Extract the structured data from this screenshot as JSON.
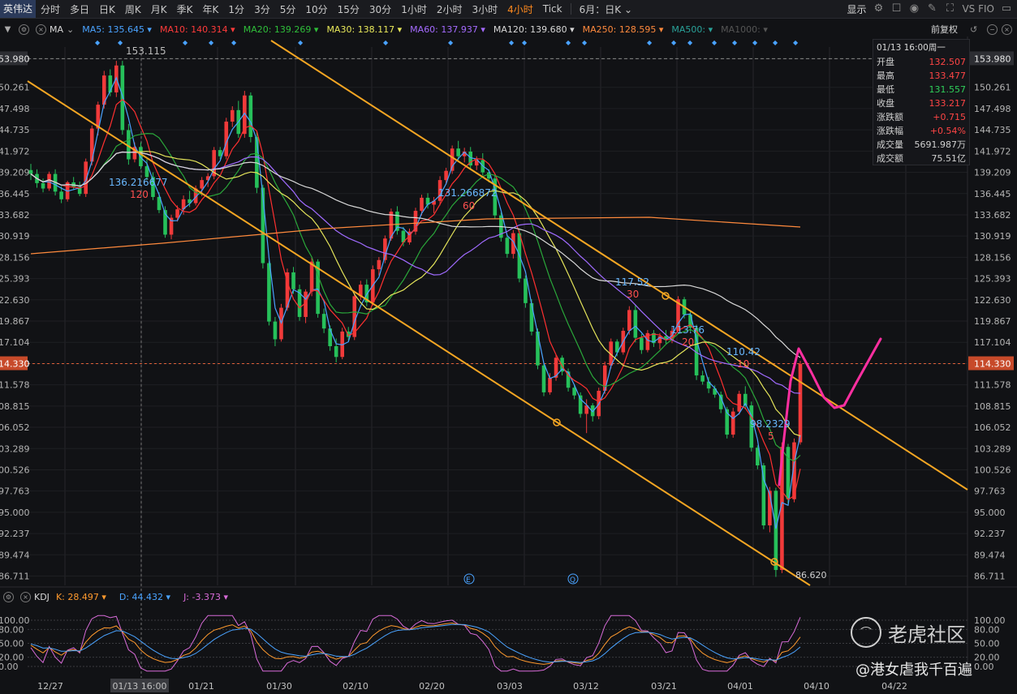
{
  "topbar": {
    "symbol": "英伟达",
    "timeframes": [
      "分时",
      "多日",
      "日K",
      "周K",
      "月K",
      "季K",
      "年K",
      "1分",
      "3分",
      "5分",
      "10分",
      "15分",
      "30分",
      "1小时",
      "2小时",
      "3小时",
      "4小时",
      "Tick"
    ],
    "active_timeframe": "4小时",
    "range_select": "6月：日K",
    "display_label": "显示",
    "vsfio_label": "VS FIO"
  },
  "ma_bar": {
    "label": "MA",
    "items": [
      {
        "name": "MA5:",
        "value": "135.645",
        "color": "#4aa3ff"
      },
      {
        "name": "MA10:",
        "value": "140.314",
        "color": "#ff3b3b"
      },
      {
        "name": "MA20:",
        "value": "139.269",
        "color": "#2fbf3a"
      },
      {
        "name": "MA30:",
        "value": "138.117",
        "color": "#e8e85a"
      },
      {
        "name": "MA60:",
        "value": "137.937",
        "color": "#a56bff"
      },
      {
        "name": "MA120:",
        "value": "139.680",
        "color": "#d8d8d8"
      },
      {
        "name": "MA250:",
        "value": "128.595",
        "color": "#ff8a3d"
      },
      {
        "name": "MA500:",
        "value": "",
        "color": "#2aa39a"
      },
      {
        "name": "MA1000:",
        "value": "",
        "color": "#555"
      }
    ],
    "adjust_label": "前复权"
  },
  "info_panel": {
    "header": "01/13 16:00周一",
    "rows": [
      {
        "k": "开盘",
        "v": "132.507",
        "color": "#ff4545"
      },
      {
        "k": "最高",
        "v": "133.477",
        "color": "#ff4545"
      },
      {
        "k": "最低",
        "v": "131.557",
        "color": "#2fcf5a"
      },
      {
        "k": "收盘",
        "v": "133.217",
        "color": "#ff4545"
      },
      {
        "k": "涨跌额",
        "v": "+0.715",
        "color": "#ff4545"
      },
      {
        "k": "涨跌幅",
        "v": "+0.54%",
        "color": "#ff4545"
      },
      {
        "k": "成交量",
        "v": "5691.987万",
        "color": "#d0d0d0"
      },
      {
        "k": "成交额",
        "v": "75.51亿",
        "color": "#d0d0d0"
      }
    ]
  },
  "kdj_bar": {
    "label": "KDJ",
    "items": [
      {
        "name": "K:",
        "value": "28.497",
        "color": "#ff9a2e"
      },
      {
        "name": "D:",
        "value": "44.432",
        "color": "#4aa3ff"
      },
      {
        "name": "J:",
        "value": "-3.373",
        "color": "#d86bd8"
      }
    ]
  },
  "chart_data": {
    "type": "candlestick",
    "y_axis_ticks": [
      "153.980",
      "150.261",
      "147.498",
      "144.735",
      "141.972",
      "139.209",
      "136.445",
      "133.682",
      "130.919",
      "128.156",
      "125.393",
      "122.630",
      "119.867",
      "117.104",
      "114.330",
      "111.578",
      "108.815",
      "106.052",
      "103.289",
      "100.526",
      "97.763",
      "95.000",
      "92.237",
      "89.474",
      "86.711"
    ],
    "y_axis_ticks_visible_left": [
      "53.980",
      "50.261",
      "47.498",
      "44.735",
      "41.972",
      "39.209",
      "36.445",
      "33.682",
      "30.919",
      "28.156",
      "25.393",
      "22.630",
      "19.867",
      "17.104",
      "14.330",
      "11.578",
      "08.815",
      "06.052",
      "03.289",
      "00.526",
      "97.763",
      "95.000",
      "92.237",
      "89.474",
      "86.711"
    ],
    "ylim": [
      85.5,
      155.5
    ],
    "x_axis_labels": [
      "12/27",
      "01/13 16:00",
      "01/21",
      "01/30",
      "02/10",
      "02/20",
      "03/03",
      "03/12",
      "03/21",
      "04/01",
      "04/10",
      "04/22"
    ],
    "price_labels": [
      {
        "text": "153.115",
        "y": 153.115
      },
      {
        "text": "136.216677",
        "y": 136.8
      },
      {
        "text": "120",
        "y": 135.3
      },
      {
        "text": "131.266872",
        "y": 134.6
      },
      {
        "text": "60",
        "y": 132.6
      },
      {
        "text": "117.52",
        "y": 123.3
      },
      {
        "text": "30",
        "y": 121.9
      },
      {
        "text": "113.76",
        "y": 117.4
      },
      {
        "text": "20",
        "y": 115.9
      },
      {
        "text": "110.42",
        "y": 114.7
      },
      {
        "text": "10",
        "y": 113.2
      },
      {
        "text": "98.2329",
        "y": 104.9
      },
      {
        "text": "5",
        "y": 103.3
      },
      {
        "text": "86.620",
        "y": 86.0
      }
    ],
    "current_price": "114.330",
    "kdj_ticks": [
      "100.00",
      "80.00",
      "50.00",
      "20.00",
      "0.00"
    ],
    "candles": [
      [
        139.5,
        140.3,
        138.2,
        139.0
      ],
      [
        139.0,
        139.6,
        137.2,
        137.8
      ],
      [
        137.8,
        138.4,
        136.6,
        137.1
      ],
      [
        137.1,
        139.3,
        136.8,
        139.0
      ],
      [
        139.0,
        139.6,
        136.2,
        136.7
      ],
      [
        136.7,
        137.4,
        135.2,
        135.7
      ],
      [
        135.7,
        138.1,
        135.4,
        137.9
      ],
      [
        137.9,
        138.6,
        136.9,
        137.3
      ],
      [
        137.3,
        138.0,
        136.1,
        136.4
      ],
      [
        136.4,
        141.0,
        136.0,
        140.6
      ],
      [
        140.6,
        145.3,
        140.1,
        144.9
      ],
      [
        144.9,
        148.4,
        144.0,
        148.0
      ],
      [
        148.0,
        152.4,
        147.5,
        151.8
      ],
      [
        151.8,
        152.6,
        149.1,
        149.6
      ],
      [
        149.6,
        153.7,
        149.0,
        153.1
      ],
      [
        153.1,
        153.7,
        144.1,
        144.7
      ],
      [
        144.7,
        145.5,
        140.2,
        140.9
      ],
      [
        140.9,
        143.1,
        140.5,
        142.5
      ],
      [
        142.5,
        143.1,
        139.6,
        140.0
      ],
      [
        140.0,
        140.9,
        138.2,
        138.6
      ],
      [
        138.6,
        139.2,
        135.6,
        136.0
      ],
      [
        136.0,
        136.6,
        133.9,
        134.3
      ],
      [
        134.3,
        134.8,
        130.7,
        131.1
      ],
      [
        131.1,
        133.7,
        130.5,
        133.3
      ],
      [
        133.3,
        134.9,
        132.8,
        134.4
      ],
      [
        134.4,
        136.2,
        133.7,
        135.7
      ],
      [
        135.7,
        136.8,
        134.7,
        135.2
      ],
      [
        135.2,
        137.5,
        134.9,
        137.1
      ],
      [
        137.1,
        138.6,
        136.1,
        138.2
      ],
      [
        138.2,
        139.1,
        137.3,
        138.7
      ],
      [
        138.7,
        142.5,
        138.3,
        142.1
      ],
      [
        142.1,
        142.5,
        140.9,
        141.3
      ],
      [
        141.3,
        146.3,
        140.9,
        145.8
      ],
      [
        145.8,
        147.8,
        145.1,
        147.3
      ],
      [
        147.3,
        148.5,
        143.7,
        144.2
      ],
      [
        144.2,
        149.8,
        143.7,
        149.2
      ],
      [
        149.2,
        149.6,
        143.1,
        143.8
      ],
      [
        143.8,
        144.5,
        136.5,
        137.2
      ],
      [
        137.2,
        137.6,
        126.7,
        127.4
      ],
      [
        127.4,
        127.7,
        119.3,
        119.8
      ],
      [
        119.8,
        120.4,
        116.6,
        117.5
      ],
      [
        117.5,
        122.1,
        117.2,
        121.6
      ],
      [
        121.6,
        126.7,
        121.2,
        126.2
      ],
      [
        126.2,
        126.9,
        123.4,
        124.0
      ],
      [
        124.0,
        124.6,
        119.9,
        120.4
      ],
      [
        120.4,
        124.0,
        119.6,
        123.7
      ],
      [
        123.7,
        128.1,
        123.1,
        127.6
      ],
      [
        127.6,
        127.9,
        120.3,
        120.8
      ],
      [
        120.8,
        121.5,
        118.3,
        118.9
      ],
      [
        118.9,
        119.3,
        116.0,
        116.6
      ],
      [
        116.6,
        117.6,
        114.5,
        115.2
      ],
      [
        115.2,
        119.0,
        114.9,
        118.5
      ],
      [
        118.5,
        119.1,
        117.3,
        117.8
      ],
      [
        117.8,
        123.5,
        117.4,
        123.1
      ],
      [
        123.1,
        125.1,
        122.6,
        124.6
      ],
      [
        124.6,
        125.3,
        121.8,
        122.3
      ],
      [
        122.3,
        127.1,
        121.9,
        126.6
      ],
      [
        126.6,
        128.2,
        125.8,
        127.8
      ],
      [
        127.8,
        131.0,
        127.4,
        130.6
      ],
      [
        130.6,
        134.5,
        130.3,
        134.1
      ],
      [
        134.1,
        134.8,
        131.1,
        131.6
      ],
      [
        131.6,
        132.1,
        129.6,
        130.1
      ],
      [
        130.1,
        131.9,
        129.8,
        131.5
      ],
      [
        131.5,
        134.6,
        131.1,
        134.2
      ],
      [
        134.2,
        136.3,
        133.6,
        135.9
      ],
      [
        135.9,
        136.5,
        134.5,
        135.0
      ],
      [
        135.0,
        136.0,
        133.9,
        135.5
      ],
      [
        135.5,
        138.7,
        134.9,
        138.2
      ],
      [
        138.2,
        139.8,
        137.6,
        139.4
      ],
      [
        139.4,
        142.7,
        139.0,
        142.3
      ],
      [
        142.3,
        143.3,
        140.8,
        141.3
      ],
      [
        141.3,
        142.4,
        140.5,
        141.9
      ],
      [
        141.9,
        142.5,
        139.6,
        140.1
      ],
      [
        140.1,
        141.3,
        139.5,
        140.8
      ],
      [
        140.8,
        141.7,
        138.8,
        139.2
      ],
      [
        139.2,
        139.6,
        137.9,
        138.4
      ],
      [
        138.4,
        138.9,
        133.1,
        133.6
      ],
      [
        133.6,
        134.0,
        130.2,
        130.7
      ],
      [
        130.7,
        131.1,
        128.1,
        128.6
      ],
      [
        128.6,
        131.7,
        128.0,
        131.3
      ],
      [
        131.3,
        131.9,
        124.9,
        125.4
      ],
      [
        125.4,
        125.8,
        121.6,
        122.2
      ],
      [
        122.2,
        122.7,
        118.0,
        118.5
      ],
      [
        118.5,
        118.9,
        113.6,
        114.1
      ],
      [
        114.1,
        114.4,
        110.1,
        110.6
      ],
      [
        110.6,
        113.1,
        110.3,
        112.5
      ],
      [
        112.5,
        115.5,
        112.1,
        115.1
      ],
      [
        115.1,
        115.4,
        112.8,
        113.3
      ],
      [
        113.3,
        113.7,
        110.7,
        111.2
      ],
      [
        111.2,
        111.6,
        109.7,
        110.2
      ],
      [
        110.2,
        110.6,
        107.3,
        107.8
      ],
      [
        107.8,
        109.7,
        105.3,
        108.9
      ],
      [
        108.9,
        109.2,
        106.8,
        107.5
      ],
      [
        107.5,
        111.2,
        107.1,
        110.8
      ],
      [
        110.8,
        114.6,
        110.4,
        114.1
      ],
      [
        114.1,
        117.6,
        113.7,
        117.2
      ],
      [
        117.2,
        117.5,
        115.3,
        115.8
      ],
      [
        115.8,
        119.0,
        115.5,
        118.6
      ],
      [
        118.6,
        121.8,
        118.1,
        121.3
      ],
      [
        121.3,
        122.0,
        117.1,
        117.7
      ],
      [
        117.7,
        118.2,
        115.6,
        116.1
      ],
      [
        116.1,
        118.7,
        115.8,
        118.3
      ],
      [
        118.3,
        118.7,
        116.5,
        117.0
      ],
      [
        117.0,
        118.3,
        116.2,
        117.9
      ],
      [
        117.9,
        118.7,
        116.9,
        117.4
      ],
      [
        117.4,
        119.0,
        117.0,
        118.6
      ],
      [
        118.6,
        123.1,
        118.3,
        122.7
      ],
      [
        122.7,
        123.0,
        120.2,
        120.7
      ],
      [
        120.7,
        121.1,
        118.5,
        119.0
      ],
      [
        119.0,
        119.4,
        112.2,
        112.8
      ],
      [
        112.8,
        113.4,
        111.6,
        112.0
      ],
      [
        112.0,
        112.6,
        110.5,
        111.1
      ],
      [
        111.1,
        111.5,
        109.9,
        110.3
      ],
      [
        110.3,
        110.7,
        107.9,
        108.4
      ],
      [
        108.4,
        108.7,
        104.6,
        105.1
      ],
      [
        105.1,
        108.6,
        104.7,
        108.1
      ],
      [
        108.1,
        110.8,
        107.7,
        110.4
      ],
      [
        110.4,
        111.4,
        108.4,
        108.9
      ],
      [
        108.9,
        109.4,
        102.9,
        103.4
      ],
      [
        103.4,
        103.7,
        100.6,
        101.1
      ],
      [
        101.1,
        101.4,
        92.8,
        93.3
      ],
      [
        93.3,
        98.3,
        92.4,
        97.8
      ],
      [
        97.8,
        98.2,
        86.6,
        87.5
      ],
      [
        87.5,
        104.1,
        87.1,
        103.5
      ],
      [
        103.5,
        103.9,
        96.1,
        96.7
      ],
      [
        96.7,
        104.6,
        96.3,
        104.1
      ],
      [
        104.1,
        114.7,
        103.8,
        114.3
      ]
    ]
  }
}
